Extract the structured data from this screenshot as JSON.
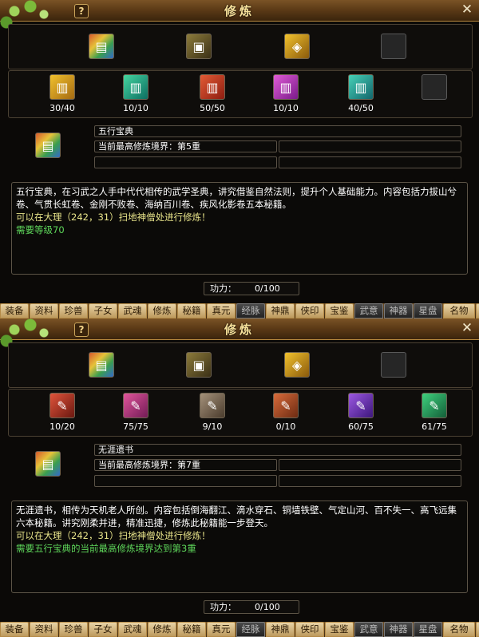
{
  "panels": [
    {
      "title": "修炼",
      "help": "?",
      "close": "✕",
      "top_slots": [
        {
          "icon": "five-element-book-icon"
        },
        {
          "icon": "treasure-scroll-icon"
        },
        {
          "icon": "golden-chest-icon"
        },
        {
          "icon": "empty-slot"
        }
      ],
      "sub_slots": [
        {
          "icon": "yellow-book-icon",
          "count": "30/40"
        },
        {
          "icon": "green-book-icon",
          "count": "10/10"
        },
        {
          "icon": "red-book-icon",
          "count": "50/50"
        },
        {
          "icon": "purple-book-icon",
          "count": "10/10"
        },
        {
          "icon": "teal-book-icon",
          "count": "40/50"
        },
        {
          "icon": "empty-slot",
          "count": ""
        }
      ],
      "selected_icon": "five-element-book-icon",
      "book_name": "五行宝典",
      "realm": "当前最高修炼境界：第5重",
      "description": "五行宝典，在习武之人手中代代相传的武学圣典，讲究借鉴自然法则，提升个人基础能力。内容包括力拔山兮卷、气贯长虹卷、金刚不败卷、海纳百川卷、疾风化影卷五本秘籍。",
      "location": "可以在大理（242，31）扫地神僧处进行修炼！",
      "requirement": "需要等级70",
      "power_label": "功力：",
      "power_value": "0/100"
    },
    {
      "title": "修炼",
      "help": "?",
      "close": "✕",
      "top_slots": [
        {
          "icon": "five-element-book-icon"
        },
        {
          "icon": "treasure-scroll-icon"
        },
        {
          "icon": "golden-chest-icon"
        },
        {
          "icon": "empty-slot"
        }
      ],
      "sub_slots": [
        {
          "icon": "red-scroll-icon",
          "count": "10/20"
        },
        {
          "icon": "pink-scroll-icon",
          "count": "75/75"
        },
        {
          "icon": "gray-scroll-icon",
          "count": "9/10"
        },
        {
          "icon": "orange-scroll-icon",
          "count": "0/10"
        },
        {
          "icon": "violet-scroll-icon",
          "count": "60/75"
        },
        {
          "icon": "green-scroll-icon",
          "count": "61/75"
        }
      ],
      "selected_icon": "treasure-scroll-icon",
      "book_name": "无涯遗书",
      "realm": "当前最高修炼境界：第7重",
      "description": "无涯遗书，相传为天机老人所创。内容包括倒海翻江、滴水穿石、铜墙铁壁、气定山河、百不失一、高飞远集六本秘籍。讲究刚柔并进，精准迅捷，修炼此秘籍能一步登天。",
      "location": "可以在大理（242，31）扫地神僧处进行修炼！",
      "requirement": "需要五行宝典的当前最高修炼境界达到第3重",
      "power_label": "功力：",
      "power_value": "0/100"
    }
  ],
  "tabs": [
    "装备",
    "资料",
    "珍兽",
    "子女",
    "武魂",
    "修炼",
    "秘籍",
    "真元",
    "经脉",
    "神鼎",
    "侠印",
    "宝鉴",
    "武意",
    "神器",
    "星盘",
    "名物",
    "其"
  ],
  "active_tabs": [
    "经脉",
    "武意",
    "神器",
    "星盘"
  ]
}
